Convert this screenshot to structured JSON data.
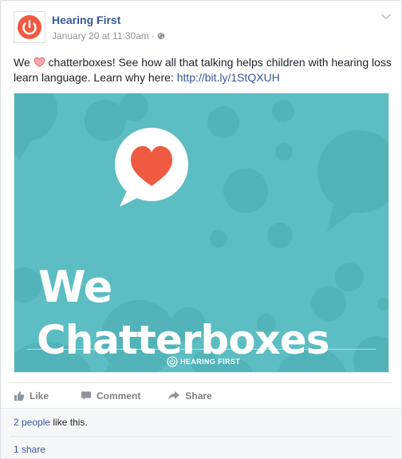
{
  "post": {
    "page_name": "Hearing First",
    "timestamp": "January 20 at 11:30am",
    "audience_icon": "globe-icon",
    "text_we": "We",
    "text_body": "chatterboxes! See how all that talking helps children with hearing loss learn language. Learn why here:",
    "link": "http://bit.ly/1StQXUH"
  },
  "image": {
    "line1": "We",
    "line2": "Chatterboxes",
    "brand": "HEARING FIRST",
    "background_color": "#5cbdc2",
    "heart_color": "#f05a42"
  },
  "actions": {
    "like": "Like",
    "comment": "Comment",
    "share": "Share"
  },
  "footer": {
    "likes_link": "2 people",
    "likes_suffix": " like this.",
    "shares": "1 share"
  },
  "colors": {
    "brand_orange": "#f05a42",
    "link_blue": "#365899"
  }
}
